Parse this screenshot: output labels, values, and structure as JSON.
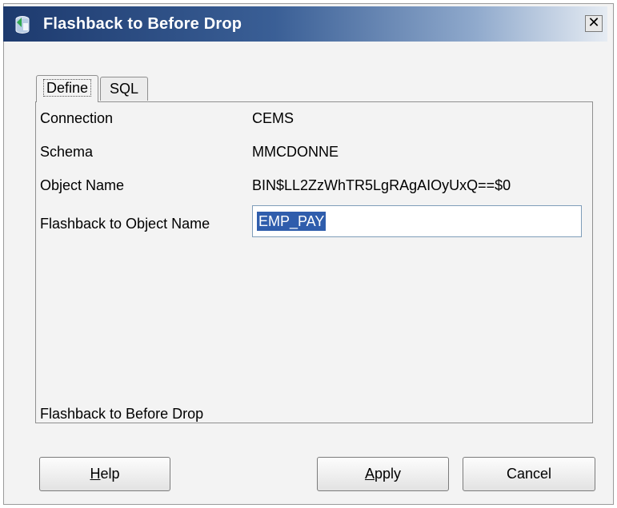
{
  "window": {
    "title": "Flashback to Before Drop",
    "close_glyph": "✕",
    "icon": "flashback-db-icon"
  },
  "tabs": [
    {
      "label": "Define",
      "active": true
    },
    {
      "label": "SQL",
      "active": false
    }
  ],
  "fields": {
    "connection": {
      "label": "Connection",
      "value": "CEMS"
    },
    "schema": {
      "label": "Schema",
      "value": "MMCDONNE"
    },
    "object_name": {
      "label": "Object Name",
      "value": "BIN$LL2ZzWhTR5LgRAgAIOyUxQ==$0"
    },
    "flashback_name": {
      "label": "Flashback to Object Name",
      "value": "EMP_PAY"
    }
  },
  "description": "Flashback to Before Drop",
  "buttons": {
    "help": {
      "mnemonic": "H",
      "rest": "elp"
    },
    "apply": {
      "mnemonic": "A",
      "rest": "pply"
    },
    "cancel": {
      "label": "Cancel"
    }
  },
  "colors": {
    "titlebar_dark": "#1d3a6e",
    "selection": "#2f5dac",
    "input_border": "#7f9db9"
  }
}
